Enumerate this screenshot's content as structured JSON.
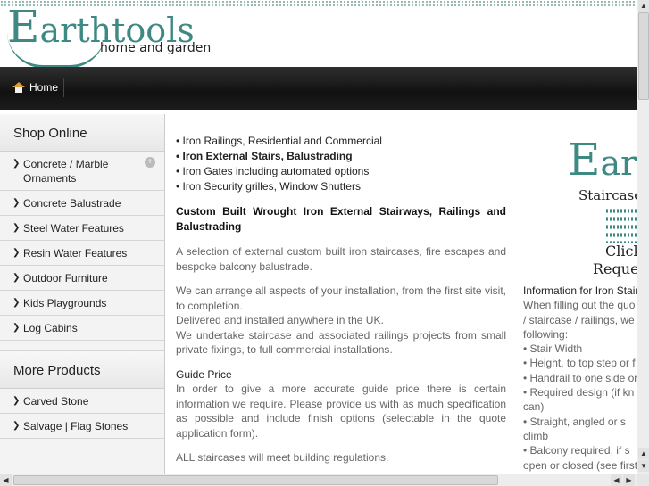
{
  "header": {
    "logo_brand_initial": "E",
    "logo_brand_rest": "arthtools",
    "logo_sub": "home and garden"
  },
  "nav": {
    "home_label": "Home"
  },
  "sidebar": {
    "shop_heading": "Shop Online",
    "shop_items": [
      {
        "label": "Concrete / Marble Ornaments"
      },
      {
        "label": "Concrete Balustrade"
      },
      {
        "label": "Steel Water Features"
      },
      {
        "label": "Resin Water Features"
      },
      {
        "label": "Outdoor Furniture"
      },
      {
        "label": "Kids Playgrounds"
      },
      {
        "label": "Log Cabins"
      }
    ],
    "more_heading": "More Products",
    "more_items": [
      {
        "label": "Carved Stone"
      },
      {
        "label": "Salvage | Flag Stones"
      }
    ]
  },
  "main": {
    "bullets": [
      "• Iron Railings, Residential and Commercial",
      "• Iron External Stairs, Balustrading",
      "• Iron Gates including automated options",
      "• Iron Security grilles, Window Shutters"
    ],
    "heading": "Custom Built Wrought Iron External Stairways, Railings and Balustrading",
    "para1": "A selection of external custom built iron staircases, fire escapes and bespoke balcony balustrade.",
    "para2_line1": "We can arrange all aspects of your installation, from the first site visit, to completion.",
    "para2_line2": "Delivered and installed anywhere in the UK.",
    "para2_line3": "We undertake staircase and associated railings projects from small private fixings, to full commercial installations.",
    "guide_title": "Guide Price",
    "guide_text": "In order to give a more accurate guide price there is certain information we require. Please provide us with as much specification as possible and include finish options (selectable in the quote application form).",
    "regs": "ALL staircases will meet building regulations."
  },
  "right": {
    "logo_initial": "E",
    "logo_rest": "arth",
    "staircase": "Staircase",
    "click": "Click",
    "request": "Reques",
    "info_title": "Information for Iron Stair",
    "info_lines": [
      "When filling out the quo",
      "/ staircase / railings, we",
      "following:",
      "• Stair Width",
      "• Height, to top step or f",
      "• Handrail to one side or",
      "• Required design (if kn",
      "can)",
      "• Straight, angled or s",
      "climb",
      "• Balcony required, if s",
      "open or closed (see first"
    ]
  },
  "scrollbars": {
    "up": "▲",
    "down": "▼",
    "left": "◀",
    "right": "▶"
  }
}
